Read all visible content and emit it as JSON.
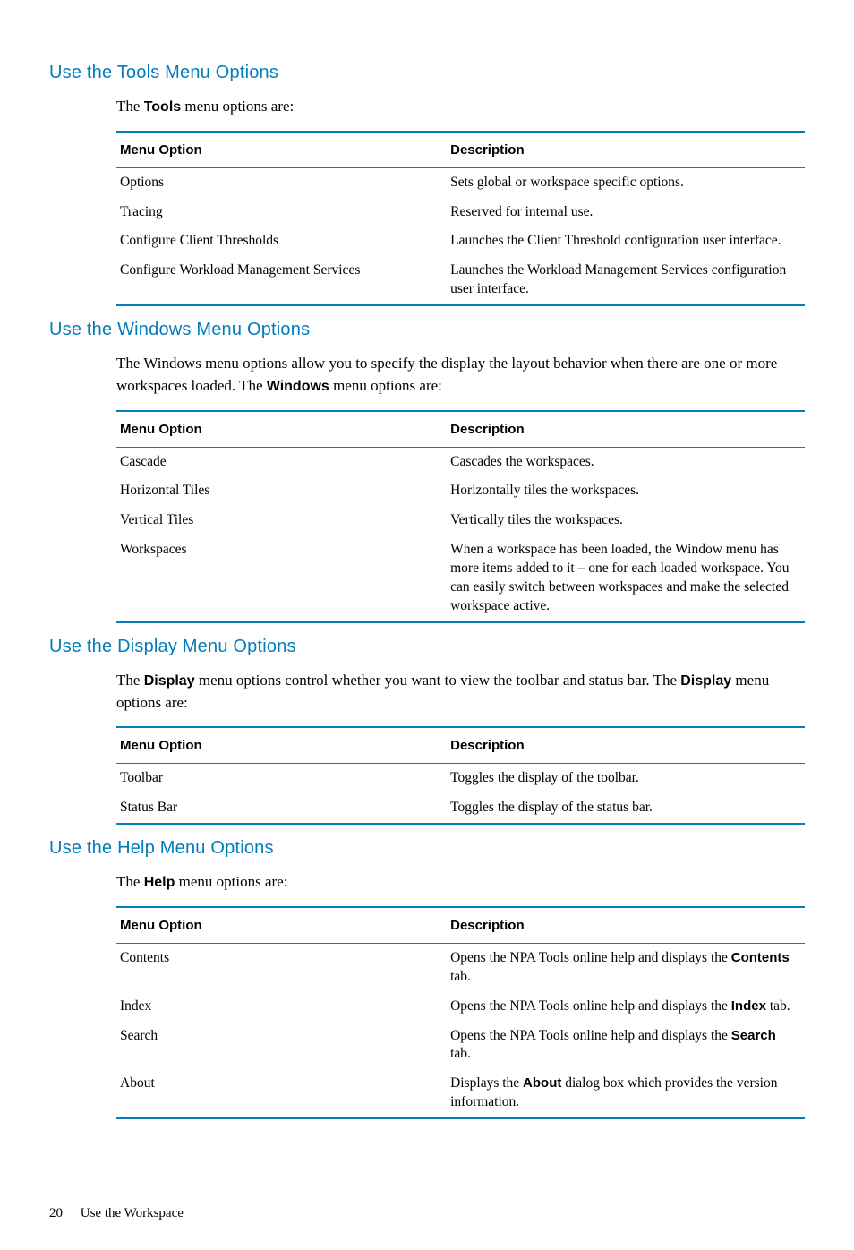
{
  "sections": [
    {
      "heading": "Use the Tools Menu Options",
      "intro_parts": [
        "The ",
        {
          "bold": "Tools"
        },
        " menu options are:"
      ],
      "headers": [
        "Menu Option",
        "Description"
      ],
      "rows": [
        {
          "option": "Options",
          "desc": [
            "Sets global or workspace specific options."
          ]
        },
        {
          "option": "Tracing",
          "desc": [
            "Reserved for internal use."
          ]
        },
        {
          "option": "Configure Client Thresholds",
          "desc": [
            "Launches the Client Threshold configuration user interface."
          ]
        },
        {
          "option": "Configure Workload Management Services",
          "desc": [
            "Launches the Workload Management Services configuration user interface."
          ]
        }
      ]
    },
    {
      "heading": "Use the Windows Menu Options",
      "intro_parts": [
        "The Windows menu options allow you to specify the display the layout behavior when there are one or more workspaces loaded. The ",
        {
          "bold": "Windows"
        },
        " menu options are:"
      ],
      "headers": [
        "Menu Option",
        "Description"
      ],
      "rows": [
        {
          "option": "Cascade",
          "desc": [
            "Cascades the workspaces."
          ]
        },
        {
          "option": "Horizontal Tiles",
          "desc": [
            "Horizontally tiles the workspaces."
          ]
        },
        {
          "option": "Vertical Tiles",
          "desc": [
            "Vertically tiles the workspaces."
          ]
        },
        {
          "option": "Workspaces",
          "desc": [
            "When a workspace has been loaded, the Window menu has more items added to it – one for each loaded workspace. You can easily switch between workspaces and make the selected workspace active."
          ]
        }
      ]
    },
    {
      "heading": "Use the Display Menu Options",
      "intro_parts": [
        "The ",
        {
          "bold": "Display"
        },
        " menu options control whether you want to view the toolbar and status bar. The ",
        {
          "bold": "Display"
        },
        " menu options are:"
      ],
      "headers": [
        "Menu Option",
        "Description"
      ],
      "rows": [
        {
          "option": "Toolbar",
          "desc": [
            "Toggles the display of the toolbar."
          ]
        },
        {
          "option": "Status Bar",
          "desc": [
            "Toggles the display of the status bar."
          ]
        }
      ]
    },
    {
      "heading": "Use the Help Menu Options",
      "intro_parts": [
        "The ",
        {
          "bold": "Help"
        },
        " menu options are:"
      ],
      "headers": [
        "Menu Option",
        "Description"
      ],
      "rows": [
        {
          "option": "Contents",
          "desc": [
            "Opens the NPA Tools online help and displays the ",
            {
              "bold": "Contents"
            },
            " tab."
          ]
        },
        {
          "option": "Index",
          "desc": [
            "Opens the NPA Tools online help and displays the ",
            {
              "bold": "Index"
            },
            " tab."
          ]
        },
        {
          "option": "Search",
          "desc": [
            "Opens the NPA Tools online help and displays the ",
            {
              "bold": "Search"
            },
            " tab."
          ]
        },
        {
          "option": "About",
          "desc": [
            "Displays the ",
            {
              "bold": "About"
            },
            " dialog box which provides the version information."
          ]
        }
      ]
    }
  ],
  "footer": {
    "page": "20",
    "chapter": "Use the Workspace"
  }
}
